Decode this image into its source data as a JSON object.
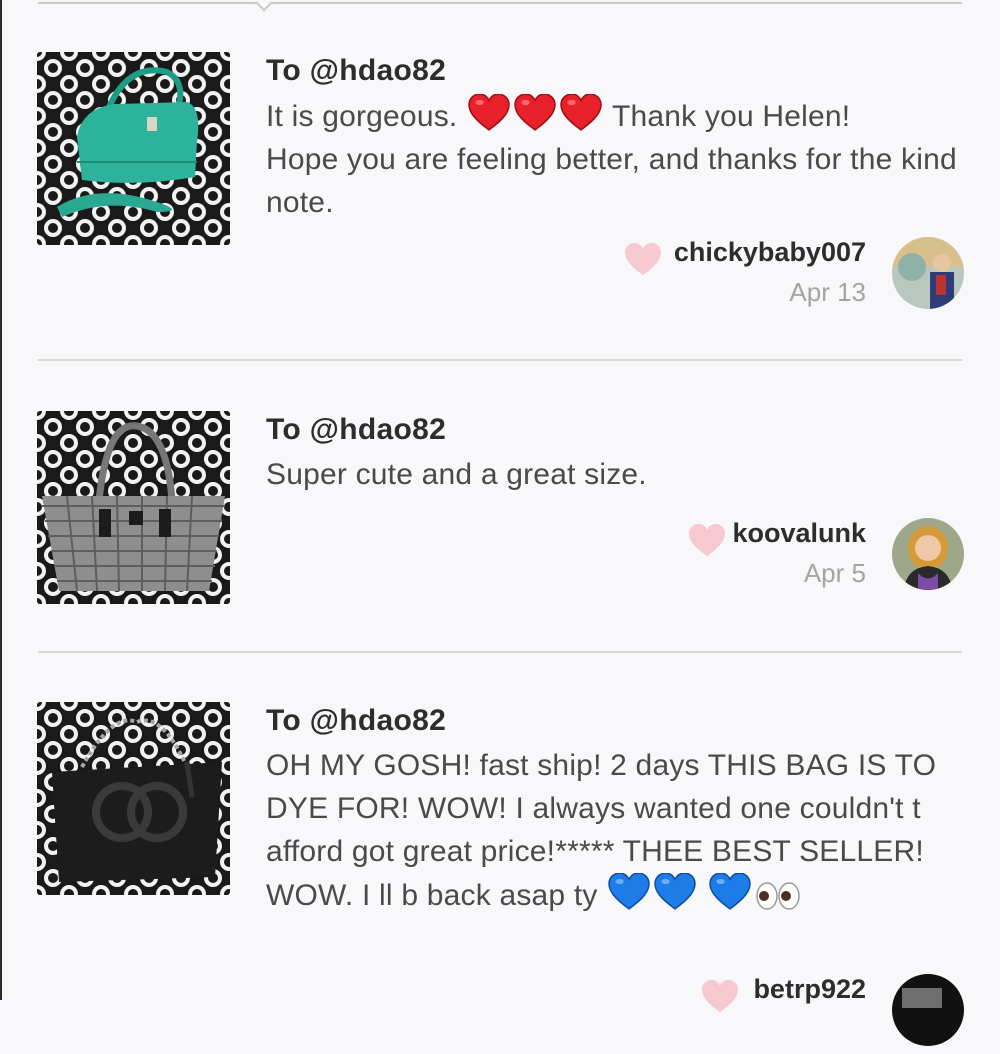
{
  "reviews": [
    {
      "to_prefix": "To ",
      "to_handle": "@hdao82",
      "message_parts": [
        "It is gorgeous.",
        "Thank you Helen!",
        "Hope you are feeling better, and thanks for the kind note."
      ],
      "username": "chickybaby007",
      "date": "Apr 13",
      "thumb_icon": "teal-handbag-photo",
      "colors": {
        "bag": "#2db39b",
        "heart": "#e8202a"
      }
    },
    {
      "to_prefix": "To ",
      "to_handle": "@hdao82",
      "message": "Super cute and a great size.",
      "username": "koovalunk",
      "date": "Apr 5",
      "thumb_icon": "woven-tote-photo",
      "colors": {
        "bag": "#8e8e8e"
      }
    },
    {
      "to_prefix": "To ",
      "to_handle": "@hdao82",
      "message_parts": [
        "OH MY GOSH! fast ship! 2 days THIS BAG IS TO DYE FOR! WOW! I always wanted one couldn't t afford got great price!***** THEE BEST SELLER! WOW. I ll b back asap ty"
      ],
      "username": "betrp922",
      "thumb_icon": "black-leather-bag-photo",
      "colors": {
        "bag": "#1c1c1c",
        "heart": "#1e7ce8"
      }
    }
  ],
  "colors": {
    "like_heart": "#f6c8cf",
    "divider": "#d8d8d8",
    "background": "#f8f7f9"
  }
}
